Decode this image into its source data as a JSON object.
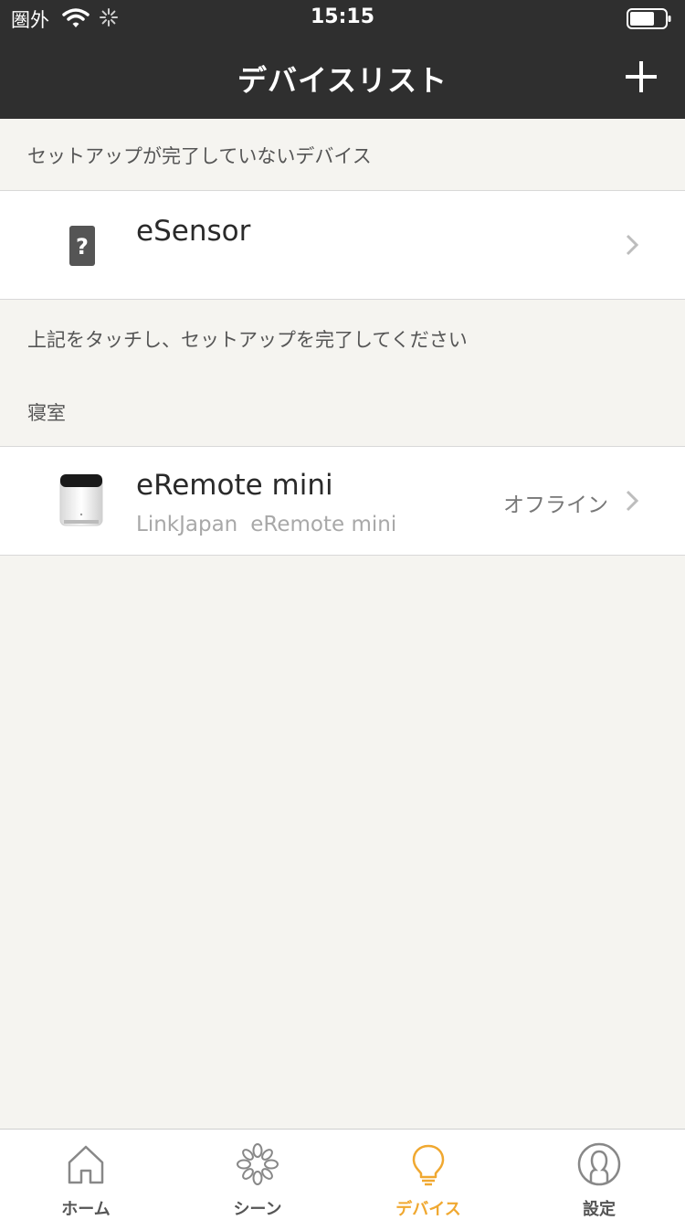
{
  "status_bar": {
    "carrier": "圏外",
    "time": "15:15"
  },
  "nav": {
    "title": "デバイスリスト",
    "add_icon": "plus-icon"
  },
  "sections": {
    "incomplete_header": "セットアップが完了していないデバイス",
    "incomplete_note": "上記をタッチし、セットアップを完了してください",
    "room_header": "寝室"
  },
  "devices": [
    {
      "name": "eSensor",
      "icon": "unknown-device-icon"
    },
    {
      "name": "eRemote mini",
      "brand": "LinkJapan",
      "model": "eRemote mini",
      "status": "オフライン",
      "icon": "eremote-mini-icon"
    }
  ],
  "tabs": [
    {
      "label": "ホーム",
      "icon": "home-icon",
      "active": false
    },
    {
      "label": "シーン",
      "icon": "scene-icon",
      "active": false
    },
    {
      "label": "デバイス",
      "icon": "bulb-icon",
      "active": true
    },
    {
      "label": "設定",
      "icon": "person-icon",
      "active": false
    }
  ],
  "colors": {
    "header_bg": "#2f2f2f",
    "page_bg": "#f5f4f0",
    "accent": "#f0a830"
  }
}
